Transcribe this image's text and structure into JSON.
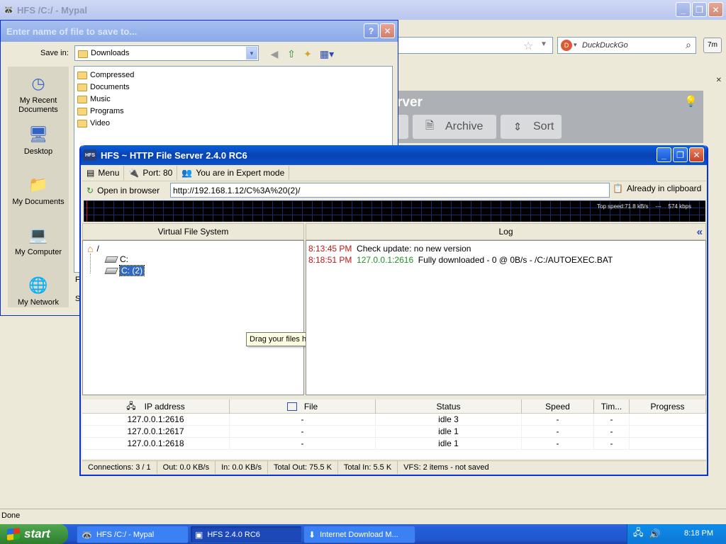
{
  "browser": {
    "title": "HFS /C:/ - Mypal",
    "search_placeholder": "DuckDuckGo",
    "zoom_label": "7m",
    "page_title_suffix": "rver",
    "buttons": {
      "archive": "Archive",
      "sort": "Sort"
    },
    "status": "Done"
  },
  "save_dialog": {
    "title": "Enter name of file to save to...",
    "save_in_label": "Save in:",
    "save_in_value": "Downloads",
    "places": [
      {
        "label": "My Recent Documents",
        "icon": "recent-documents-icon"
      },
      {
        "label": "Desktop",
        "icon": "desktop-icon"
      },
      {
        "label": "My Documents",
        "icon": "my-documents-icon"
      },
      {
        "label": "My Computer",
        "icon": "my-computer-icon"
      },
      {
        "label": "My Network",
        "icon": "my-network-icon"
      }
    ],
    "folders": [
      "Compressed",
      "Documents",
      "Music",
      "Programs",
      "Video"
    ],
    "cut_label_1": "F",
    "cut_label_2": "S"
  },
  "hfs": {
    "title": "HFS ~ HTTP File Server 2.4.0 RC6",
    "logo": "HFS",
    "toolbar": {
      "menu": "Menu",
      "port": "Port: 80",
      "mode": "You are in Expert mode",
      "open_browser": "Open in browser",
      "url": "http://192.168.1.12/C%3A%20(2)/",
      "clipboard": "Already in clipboard"
    },
    "graph": {
      "top_speed": "Top speed:71.8 kB/s",
      "sep": "---",
      "kbps": "574 kbps"
    },
    "vfs": {
      "header": "Virtual File System",
      "root": "/",
      "items": [
        "C:",
        "C: (2)"
      ],
      "tooltip": "Drag your files here"
    },
    "log": {
      "header": "Log",
      "collapse": "«",
      "lines": [
        {
          "time": "8:13:45 PM",
          "ip": "",
          "text": "Check update: no new version"
        },
        {
          "time": "8:18:51 PM",
          "ip": "127.0.0.1:2616",
          "text": "Fully downloaded - 0 @ 0B/s - /C:/AUTOEXEC.BAT"
        }
      ]
    },
    "connections": {
      "columns": [
        "IP address",
        "File",
        "Status",
        "Speed",
        "Tim...",
        "Progress"
      ],
      "rows": [
        [
          "127.0.0.1:2616",
          "-",
          "idle 3",
          "-",
          "-",
          ""
        ],
        [
          "127.0.0.1:2617",
          "-",
          "idle 1",
          "-",
          "-",
          ""
        ],
        [
          "127.0.0.1:2618",
          "-",
          "idle 1",
          "-",
          "-",
          ""
        ]
      ]
    },
    "status": {
      "connections": "Connections: 3 / 1",
      "out": "Out: 0.0 KB/s",
      "in": "In: 0.0 KB/s",
      "total_out": "Total Out: 75.5 K",
      "total_in": "Total In: 5.5 K",
      "vfs": "VFS: 2 items - not saved"
    }
  },
  "taskbar": {
    "start": "start",
    "tasks": [
      "HFS /C:/ - Mypal",
      "HFS 2.4.0 RC6",
      "Internet Download M..."
    ],
    "clock": "8:18 PM"
  }
}
